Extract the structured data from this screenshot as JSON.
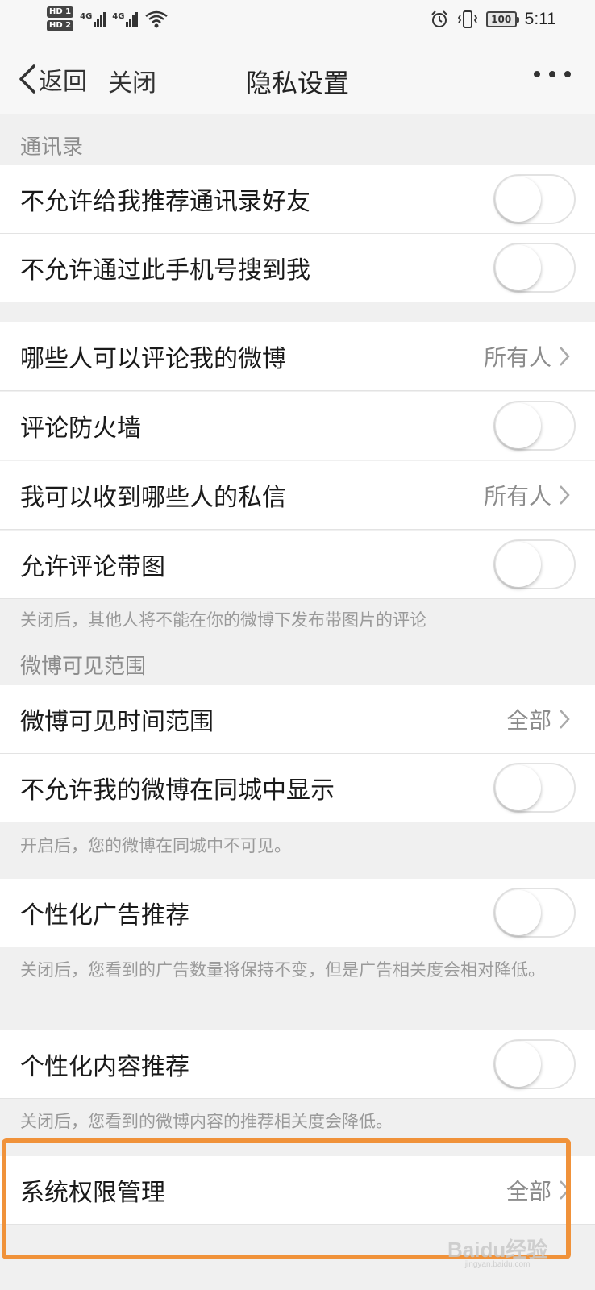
{
  "status_bar": {
    "hd1": "HD 1",
    "hd2": "HD 2",
    "net1": "4G",
    "net2": "4G",
    "battery": "100",
    "time": "5:11",
    "icons": [
      "alarm-icon",
      "vibrate-icon",
      "wifi-icon"
    ]
  },
  "nav": {
    "back_label": "返回",
    "close_label": "关闭",
    "title": "隐私设置"
  },
  "sections": {
    "contacts_header": "通讯录",
    "weibo_visibility_header": "微博可见范围"
  },
  "rows": {
    "no_recommend_contacts": "不允许给我推荐通讯录好友",
    "no_search_by_phone": "不允许通过此手机号搜到我",
    "who_can_comment": "哪些人可以评论我的微博",
    "who_can_comment_value": "所有人",
    "comment_firewall": "评论防火墙",
    "who_can_message": "我可以收到哪些人的私信",
    "who_can_message_value": "所有人",
    "allow_image_comments": "允许评论带图",
    "visible_time_range": "微博可见时间范围",
    "visible_time_range_value": "全部",
    "hide_in_local": "不允许我的微博在同城中显示",
    "personalized_ads": "个性化广告推荐",
    "personalized_content": "个性化内容推荐",
    "system_permissions": "系统权限管理",
    "system_permissions_value": "全部"
  },
  "toggles": {
    "no_recommend_contacts": false,
    "no_search_by_phone": false,
    "comment_firewall": false,
    "allow_image_comments": false,
    "hide_in_local": false,
    "personalized_ads": false,
    "personalized_content": false
  },
  "notes": {
    "image_comments_note": "关闭后，其他人将不能在你的微博下发布带图片的评论",
    "local_note": "开启后，您的微博在同城中不可见。",
    "ads_note": "关闭后，您看到的广告数量将保持不变，但是广告相关度会相对降低。",
    "content_note": "关闭后，您看到的微博内容的推荐相关度会降低。"
  },
  "watermark": {
    "brand": "Baidu经验",
    "domain": "jingyan.baidu.com"
  },
  "colors": {
    "highlight": "#f0923a",
    "background": "#f0f0f0",
    "secondary_text": "#8c8c8c"
  }
}
